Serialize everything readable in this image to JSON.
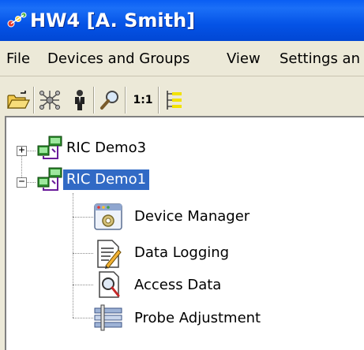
{
  "window": {
    "title": "HW4 [A. Smith]",
    "title_icon": "hw4-app-icon"
  },
  "menu": [
    {
      "label": "File"
    },
    {
      "label": "Devices and Groups"
    },
    {
      "label": "View"
    },
    {
      "label": "Settings an"
    }
  ],
  "toolbar": {
    "buttons": [
      {
        "icon": "open-folder-icon"
      },
      {
        "icon": "network-icon"
      },
      {
        "icon": "person-icon"
      },
      {
        "icon": "search-icon"
      },
      {
        "icon": "zoom-1to1-icon",
        "label": "1:1"
      },
      {
        "icon": "list-icon"
      }
    ]
  },
  "tree": {
    "nodes": [
      {
        "label": "RIC Demo3",
        "expander": "+",
        "icon": "device-network-icon"
      },
      {
        "label": "RIC Demo1",
        "expander": "−",
        "icon": "device-network-icon",
        "selected": true,
        "children": [
          {
            "label": "Device Manager",
            "icon": "device-manager-icon"
          },
          {
            "label": "Data Logging",
            "icon": "data-logging-icon"
          },
          {
            "label": "Access Data",
            "icon": "access-data-icon"
          },
          {
            "label": "Probe Adjustment",
            "icon": "probe-adjustment-icon"
          }
        ]
      }
    ]
  }
}
